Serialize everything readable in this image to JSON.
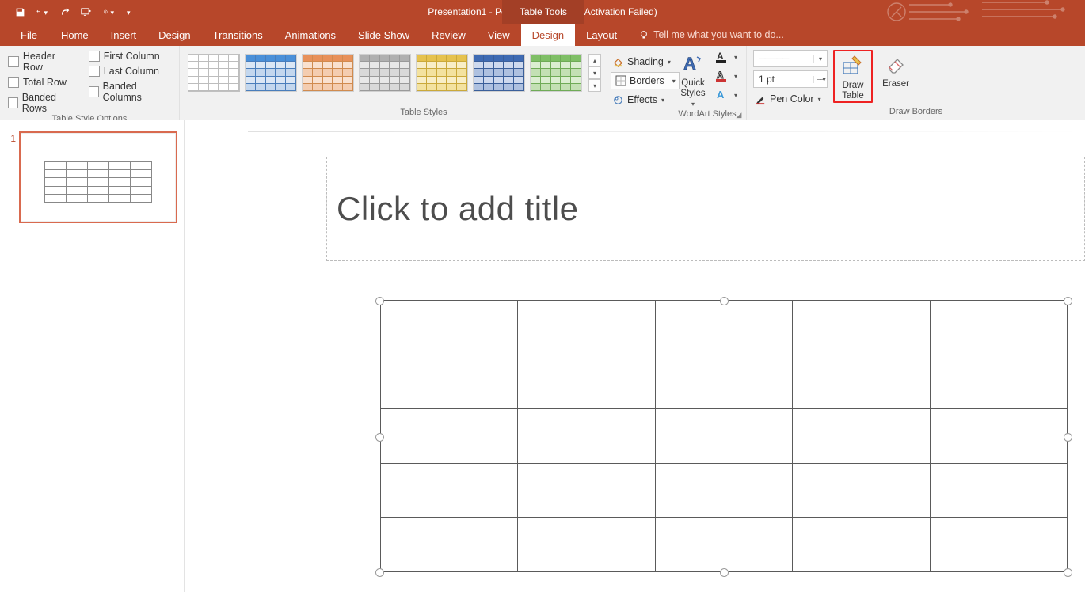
{
  "title": "Presentation1 - PowerPoint (Product Activation Failed)",
  "contextual_tab": "Table Tools",
  "qat": {
    "save": "save",
    "undo": "undo",
    "redo": "redo",
    "start": "start-from-beginning",
    "touch": "touch-mode"
  },
  "tabs": {
    "file": "File",
    "home": "Home",
    "insert": "Insert",
    "design_app": "Design",
    "transitions": "Transitions",
    "animations": "Animations",
    "slideshow": "Slide Show",
    "review": "Review",
    "view": "View",
    "design_tt": "Design",
    "layout_tt": "Layout",
    "tell_me": "Tell me what you want to do..."
  },
  "groups": {
    "style_options": {
      "label": "Table Style Options",
      "header_row": "Header Row",
      "total_row": "Total Row",
      "banded_rows": "Banded Rows",
      "first_column": "First Column",
      "last_column": "Last Column",
      "banded_columns": "Banded Columns"
    },
    "table_styles": {
      "label": "Table Styles",
      "shading": "Shading",
      "borders": "Borders",
      "effects": "Effects"
    },
    "wordart": {
      "label": "WordArt Styles",
      "quick_styles": "Quick Styles"
    },
    "draw_borders": {
      "label": "Draw Borders",
      "pen_style": "────────",
      "pen_weight": "1 pt",
      "pen_color": "Pen Color",
      "draw_table": "Draw Table",
      "eraser": "Eraser"
    }
  },
  "slide": {
    "number": "1",
    "title_placeholder": "Click to add title",
    "table": {
      "rows": 5,
      "cols": 5
    }
  },
  "style_swatches": [
    {
      "name": "plain",
      "border": "#bdbdbd",
      "header": "#ffffff",
      "body": "#ffffff",
      "alt": "#ffffff"
    },
    {
      "name": "style-blue",
      "border": "#4a7ebb",
      "header": "#4a90d9",
      "body": "#c3d7ee",
      "alt": "#dbe7f5"
    },
    {
      "name": "style-orange",
      "border": "#d08b4f",
      "header": "#e8915a",
      "body": "#f4cdb0",
      "alt": "#f9e1cf"
    },
    {
      "name": "style-gray",
      "border": "#9a9a9a",
      "header": "#b0b0b0",
      "body": "#d9d9d9",
      "alt": "#e8e8e8"
    },
    {
      "name": "style-gold",
      "border": "#caa93b",
      "header": "#e6c24d",
      "body": "#f3e2a0",
      "alt": "#f8eec7"
    },
    {
      "name": "style-navy",
      "border": "#3a5f9a",
      "header": "#3f6bb3",
      "body": "#aec1e0",
      "alt": "#cdd9ee"
    },
    {
      "name": "style-green",
      "border": "#6fab57",
      "header": "#7fbf66",
      "body": "#c3e0b4",
      "alt": "#dbeed1"
    }
  ]
}
